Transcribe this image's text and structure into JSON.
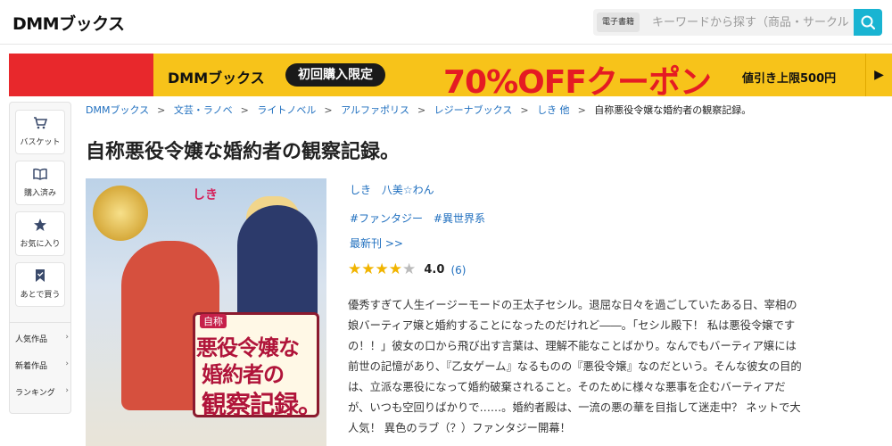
{
  "header": {
    "logo": "DMMブックス",
    "search_category": "電子書籍",
    "search_placeholder": "キーワードから探す（商品・サークル・作家）"
  },
  "banner": {
    "logo": "DMMブックス",
    "pill": "初回購入限定",
    "main": "70%OFFクーポン",
    "sub": "値引き上限500円",
    "arrow": "▶"
  },
  "sidenav": {
    "tiles": [
      {
        "label": "バスケット",
        "icon": "cart-icon"
      },
      {
        "label": "購入済み",
        "icon": "book-icon"
      },
      {
        "label": "お気に入り",
        "icon": "star-icon"
      },
      {
        "label": "あとで買う",
        "icon": "bookmark-icon"
      }
    ],
    "links": [
      {
        "label": "人気作品"
      },
      {
        "label": "新着作品"
      },
      {
        "label": "ランキング"
      }
    ],
    "chevron": "›"
  },
  "breadcrumb": {
    "items": [
      "DMMブックス",
      "文芸・ラノベ",
      "ライトノベル",
      "アルファポリス",
      "レジーナブックス",
      "しき 他"
    ],
    "separator": ">",
    "current": "自称悪役令嬢な婚約者の観察記録。"
  },
  "product": {
    "title": "自称悪役令嬢な婚約者の観察記録。",
    "authors": [
      "しき",
      "八美☆わん"
    ],
    "tags": [
      "#ファンタジー",
      "#異世界系"
    ],
    "latest_link": "最新刊 >>",
    "rating": {
      "value": "4.0",
      "count": "(6)",
      "stars_filled": 4,
      "stars_total": 5
    },
    "description_lines": [
      "優秀すぎて人生イージーモードの王太子セシル。退屈な日々を過ごしていたある日、宰相の",
      "娘バーティア嬢と婚約することになったのだけれど――。「セシル殿下！ 私は悪役令嬢です",
      "の！！」彼女の口から飛び出す言葉は、理解不能なことばかり。なんでもバーティア嬢には",
      "前世の記憶があり、『乙女ゲーム』なるものの『悪役令嬢』なのだという。そんな彼女の目的",
      "は、立派な悪役になって婚約破棄されること。そのために様々な悪事を企むバーティアだ",
      "が、いつも空回りばかりで……。婚約者殿は、一流の悪の華を目指して迷走中？ ネットで大",
      "人気！ 異色のラブ（？）ファンタジー開幕！"
    ]
  },
  "cover": {
    "author": "しき",
    "badge": "自称",
    "line1": "悪役令嬢な",
    "line2": "婚約者の",
    "line3": "観察記録。"
  },
  "colors": {
    "link": "#1f6fbf",
    "accent": "#19b4d2",
    "banner_red": "#e8282c",
    "banner_yellow": "#f7c31a",
    "star": "#f1b400"
  }
}
